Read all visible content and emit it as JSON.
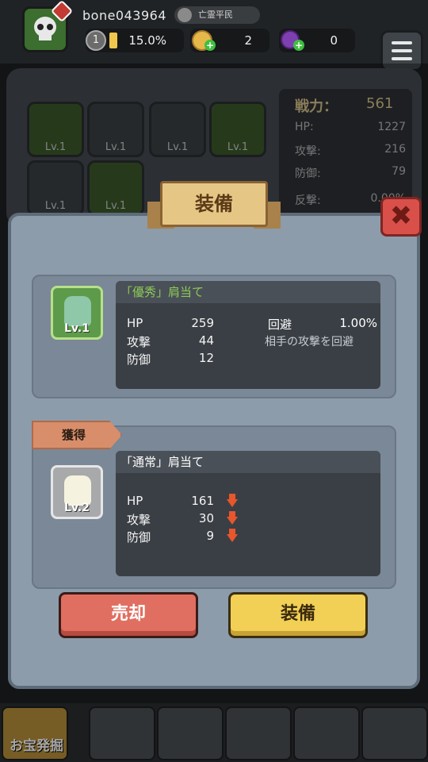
{
  "topbar": {
    "username": "bone043964",
    "rank": "亡霊平民",
    "level": "1",
    "progress": "15.0%",
    "coins": "2",
    "gems": "0"
  },
  "inventory": {
    "slot_labels": [
      "Lv.1",
      "Lv.1",
      "Lv.1",
      "Lv.1",
      "Lv.1",
      "Lv.1"
    ]
  },
  "side_stats": {
    "power_label": "戦力：",
    "power_value": "561",
    "rows": [
      {
        "label": "HP:",
        "value": "1227"
      },
      {
        "label": "攻撃:",
        "value": "216"
      },
      {
        "label": "防御:",
        "value": "79"
      },
      {
        "label": "反撃:",
        "value": "0.00%"
      }
    ]
  },
  "modal": {
    "title": "装備",
    "close_symbol": "✖",
    "equipped": {
      "name": "「優秀」肩当て",
      "level": "Lv.1",
      "stats": [
        {
          "label": "HP",
          "value": "259"
        },
        {
          "label": "攻撃",
          "value": "44"
        },
        {
          "label": "防御",
          "value": "12"
        }
      ],
      "special_label": "回避",
      "special_value": "1.00%",
      "special_desc": "相手の攻撃を回避"
    },
    "acquired_tag": "獲得",
    "acquired": {
      "name": "「通常」肩当て",
      "level": "Lv.2",
      "stats": [
        {
          "label": "HP",
          "value": "161"
        },
        {
          "label": "攻撃",
          "value": "30"
        },
        {
          "label": "防御",
          "value": "9"
        }
      ]
    },
    "sell_button": "売却",
    "equip_button": "装備"
  },
  "bottomnav": {
    "active_label": "お宝発掘"
  },
  "colors": {
    "rare_text": "#8ccb54",
    "sell_button": "#e06f61",
    "equip_button": "#f2cf55",
    "stat_down_arrow": "#e8562c"
  }
}
